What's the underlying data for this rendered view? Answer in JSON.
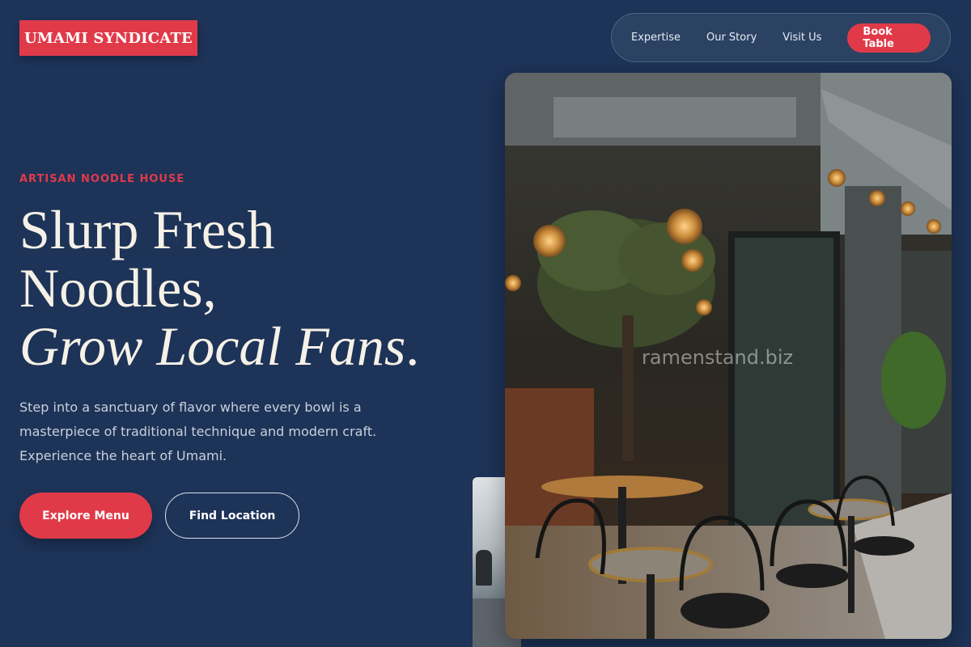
{
  "brand": {
    "logo_text": "UMAMI SYNDICATE"
  },
  "nav": {
    "links": [
      "Expertise",
      "Our Story",
      "Visit Us"
    ],
    "cta_label": "Book Table"
  },
  "hero": {
    "eyebrow": "ARTISAN NOODLE HOUSE",
    "headline_line1": "Slurp Fresh",
    "headline_line2": "Noodles,",
    "headline_line3_italic": "Grow Local Fans",
    "headline_line3_end": ".",
    "lead": "Step into a sanctuary of flavor where every bowl is a masterpiece of traditional technique and modern craft. Experience the heart of Umami.",
    "primary_button": "Explore Menu",
    "secondary_button": "Find Location"
  },
  "image": {
    "watermark": "ramenstand.biz"
  },
  "colors": {
    "background": "#1d3358",
    "accent": "#e03a49",
    "text": "#f6f1e7"
  }
}
